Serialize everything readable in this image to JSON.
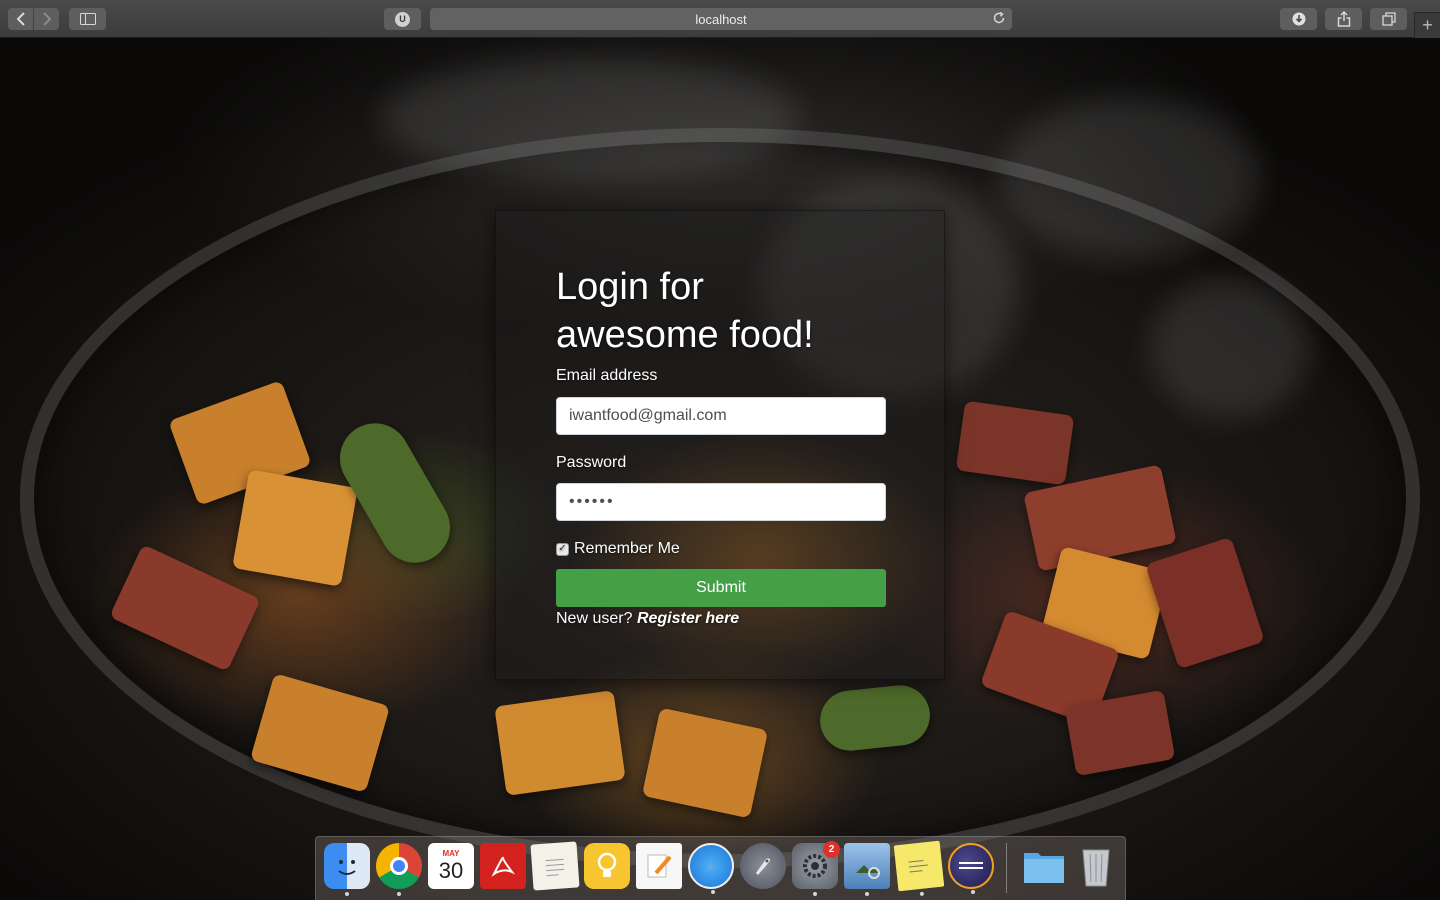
{
  "browser": {
    "url": "localhost",
    "extension_letter": "U"
  },
  "login": {
    "title": "Login for awesome food!",
    "email_label": "Email address",
    "email_value": "iwantfood@gmail.com",
    "password_label": "Password",
    "password_value": "••••••",
    "remember_label": "Remember Me",
    "remember_checked": true,
    "submit_label": "Submit",
    "new_user_text": "New user?",
    "register_link": "Register here",
    "submit_color": "#43a047"
  },
  "dock": {
    "calendar_month": "MAY",
    "calendar_day": "30",
    "system_prefs_badge": "2",
    "apps": [
      "finder-icon",
      "chrome-icon",
      "calendar-icon",
      "acrobat-icon",
      "textedit-icon",
      "tips-icon",
      "pages-icon",
      "safari-icon",
      "launchpad-icon",
      "system-preferences-icon",
      "preview-icon",
      "stickies-icon",
      "eclipse-icon",
      "downloads-folder-icon",
      "trash-icon"
    ]
  }
}
